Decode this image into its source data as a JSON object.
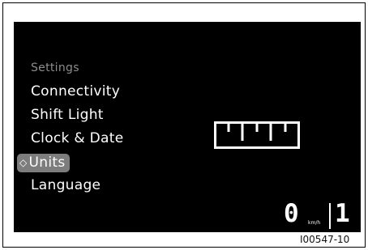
{
  "menu": {
    "header": "Settings",
    "items": [
      {
        "label": "Connectivity"
      },
      {
        "label": "Shift Light"
      },
      {
        "label": "Clock & Date"
      },
      {
        "label": "Units",
        "selected": true
      },
      {
        "label": "Language"
      }
    ],
    "selected_icon": "diamond-arrow-icon"
  },
  "preview_icon": "ruler-icon",
  "status": {
    "speed": "0",
    "speed_unit": "km/h",
    "gear": "1"
  },
  "figure_code": "I00547-10",
  "colors": {
    "screen_background": "#000000",
    "selected_highlight": "#7d7d7d",
    "header_text": "#8c8c8c",
    "item_text": "#ffffff"
  }
}
